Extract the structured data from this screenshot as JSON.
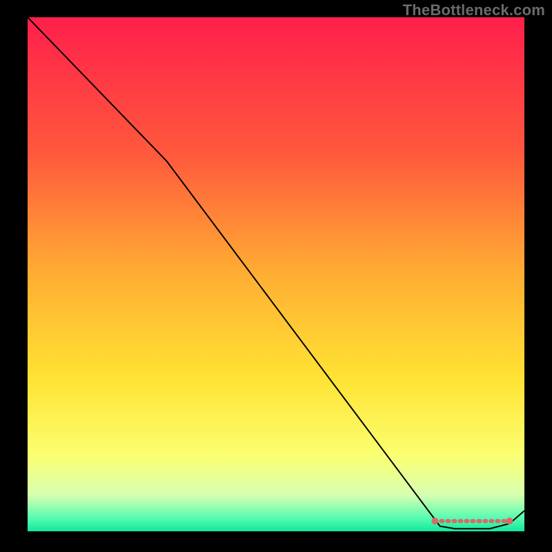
{
  "watermark": "TheBottleneck.com",
  "chart_data": {
    "type": "line",
    "title": "",
    "xlabel": "",
    "ylabel": "",
    "xlim": [
      0,
      100
    ],
    "ylim": [
      0,
      100
    ],
    "grid": false,
    "legend": false,
    "gradient_stops": [
      {
        "offset": 0.0,
        "color": "#ff1f4b"
      },
      {
        "offset": 0.27,
        "color": "#ff5a3c"
      },
      {
        "offset": 0.5,
        "color": "#ffae33"
      },
      {
        "offset": 0.7,
        "color": "#ffe233"
      },
      {
        "offset": 0.85,
        "color": "#fbff70"
      },
      {
        "offset": 0.93,
        "color": "#d7ffb0"
      },
      {
        "offset": 0.975,
        "color": "#54fbb1"
      },
      {
        "offset": 1.0,
        "color": "#12e89c"
      }
    ],
    "series": [
      {
        "name": "bottleneck-curve",
        "color": "#000000",
        "stroke_width": 2,
        "x": [
          0,
          28,
          83,
          86,
          93,
          97,
          100
        ],
        "y": [
          100,
          72,
          1,
          0.5,
          0.5,
          1.5,
          4
        ]
      }
    ],
    "highlight": {
      "name": "sweet-spot",
      "color": "#d86a6a",
      "stroke_width": 6,
      "dash": [
        2,
        7
      ],
      "x": [
        82,
        97
      ],
      "y": [
        2,
        2
      ],
      "endpoints": true
    }
  }
}
